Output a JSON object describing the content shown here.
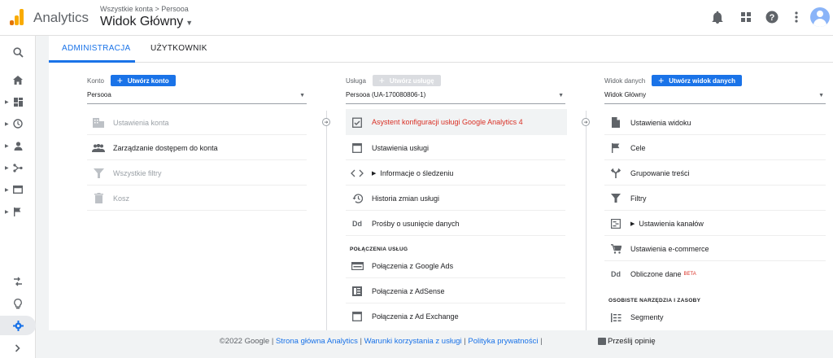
{
  "header": {
    "app_name": "Analytics",
    "breadcrumb": "Wszystkie konta > Persooa",
    "view_title": "Widok Główny"
  },
  "tabs": [
    {
      "label": "ADMINISTRACJA",
      "active": true
    },
    {
      "label": "UŻYTKOWNIK",
      "active": false
    }
  ],
  "account": {
    "label": "Konto",
    "create_button": "Utwórz konto",
    "selected": "Persooa",
    "items": [
      {
        "label": "Ustawienia konta",
        "icon": "building-icon",
        "disabled": true
      },
      {
        "label": "Zarządzanie dostępem do konta",
        "icon": "people-icon",
        "disabled": false
      },
      {
        "label": "Wszystkie filtry",
        "icon": "filter-icon",
        "disabled": true
      },
      {
        "label": "Kosz",
        "icon": "trash-icon",
        "disabled": true
      }
    ]
  },
  "property": {
    "label": "Usługa",
    "create_button": "Utwórz usługę",
    "selected": "Persooa (UA-170080806-1)",
    "items": [
      {
        "label": "Asystent konfiguracji usługi Google Analytics 4",
        "icon": "checklist-icon"
      },
      {
        "label": "Ustawienia usługi",
        "icon": "window-icon"
      },
      {
        "label": "Informacje o śledzeniu",
        "icon": "code-icon"
      },
      {
        "label": "Historia zmian usługi",
        "icon": "history-icon"
      },
      {
        "label": "Prośby o usunięcie danych",
        "icon": "dd-icon"
      }
    ],
    "section_title": "POŁĄCZENIA USŁUG",
    "links": [
      {
        "label": "Połączenia z Google Ads",
        "icon": "ads-icon"
      },
      {
        "label": "Połączenia z AdSense",
        "icon": "adsense-icon"
      },
      {
        "label": "Połączenia z Ad Exchange",
        "icon": "adexchange-icon"
      }
    ]
  },
  "view": {
    "label": "Widok danych",
    "create_button": "Utwórz widok danych",
    "selected": "Widok Główny",
    "items": [
      {
        "label": "Ustawienia widoku",
        "icon": "document-icon"
      },
      {
        "label": "Cele",
        "icon": "flag-icon"
      },
      {
        "label": "Grupowanie treści",
        "icon": "merge-icon"
      },
      {
        "label": "Filtry",
        "icon": "filter-icon"
      },
      {
        "label": "Ustawienia kanałów",
        "icon": "channels-icon"
      },
      {
        "label": "Ustawienia e-commerce",
        "icon": "cart-icon"
      },
      {
        "label": "Obliczone dane",
        "icon": "dd-icon",
        "badge": "BETA"
      }
    ],
    "section_title": "OSOBISTE NARZĘDZIA I ZASOBY",
    "tools": [
      {
        "label": "Segmenty",
        "icon": "segments-icon"
      }
    ]
  },
  "footer": {
    "copyright": "©2022 Google",
    "link_home": "Strona główna Analytics",
    "link_terms": "Warunki korzystania z usługi",
    "link_privacy": "Polityka prywatności",
    "feedback": "Prześlij opinię"
  }
}
